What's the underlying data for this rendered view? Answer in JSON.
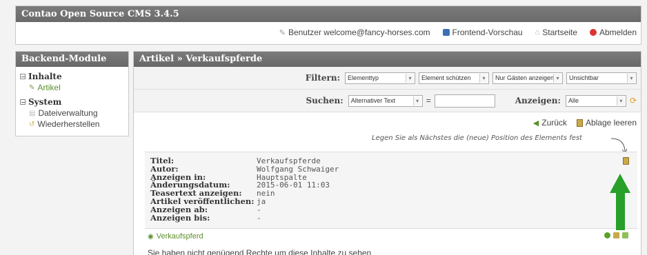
{
  "app": {
    "title": "Contao Open Source CMS 3.4.5"
  },
  "toplinks": {
    "user": "Benutzer welcome@fancy-horses.com",
    "preview": "Frontend-Vorschau",
    "home": "Startseite",
    "logout": "Abmelden"
  },
  "sidebar": {
    "heading": "Backend-Module",
    "sections": [
      {
        "label": "Inhalte",
        "items": [
          "Artikel"
        ]
      },
      {
        "label": "System",
        "items": [
          "Dateiverwaltung",
          "Wiederherstellen"
        ]
      }
    ]
  },
  "main": {
    "breadcrumb": "Artikel » Verkaufspferde",
    "filter": {
      "label": "Filtern:",
      "selects": [
        "Elementtyp",
        "Element schützen",
        "Nur Gästen anzeigen",
        "Unsichtbar"
      ]
    },
    "search": {
      "label": "Suchen:",
      "field": "Alternativer Text",
      "equals": "=",
      "show_label": "Anzeigen:",
      "show_value": "Alle"
    },
    "actions": {
      "back": "Zurück",
      "clear": "Ablage leeren"
    },
    "hint": "Legen Sie als Nächstes die (neue) Position des Elements fest",
    "article": {
      "rows": [
        {
          "label": "Titel:",
          "value": "Verkaufspferde"
        },
        {
          "label": "Autor:",
          "value": "Wolfgang Schwaiger"
        },
        {
          "label": "Anzeigen in:",
          "value": "Hauptspalte"
        },
        {
          "label": "Änderungsdatum:",
          "value": "2015-06-01 11:03"
        },
        {
          "label": "Teasertext anzeigen:",
          "value": "nein"
        },
        {
          "label": "Artikel veröffentlichen:",
          "value": "ja"
        },
        {
          "label": "Anzeigen ab:",
          "value": "-"
        },
        {
          "label": "Anzeigen bis:",
          "value": "-"
        }
      ]
    },
    "element": {
      "label": "Verkaufspferd"
    },
    "notice": "Sie haben nicht genügend Rechte um diese Inhalte zu sehen"
  },
  "colors": {
    "header": "#6f6f6f",
    "accent_green": "#28a02a",
    "link_green": "#5d8f2b"
  }
}
